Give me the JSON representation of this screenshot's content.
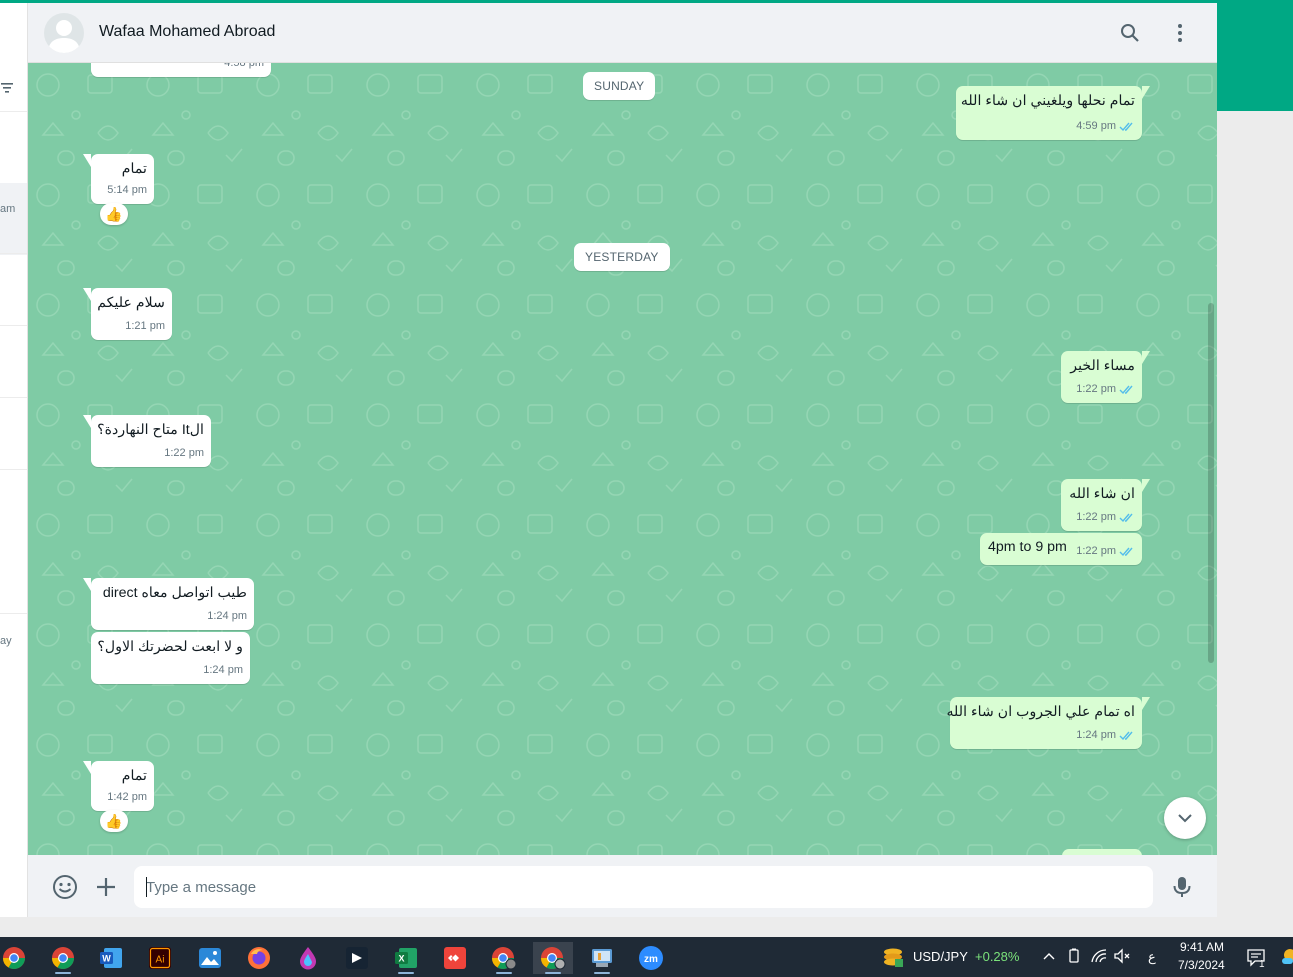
{
  "header": {
    "contact_name": "Wafaa Mohamed Abroad"
  },
  "chatlist": {
    "snippet_1": "am",
    "snippet_2": "ay"
  },
  "messages": [
    {
      "direction": "in",
      "text": "",
      "time": "4:58 pm"
    },
    {
      "type": "date",
      "text": "SUNDAY"
    },
    {
      "direction": "out",
      "text": "تمام نحلها ويلغيني ان شاء الله",
      "time": "4:59 pm",
      "status": "read"
    },
    {
      "direction": "in",
      "text": "تمام",
      "time": "5:14 pm",
      "reaction": "👍"
    },
    {
      "type": "date",
      "text": "YESTERDAY"
    },
    {
      "direction": "in",
      "text": "سلام عليكم",
      "time": "1:21 pm"
    },
    {
      "direction": "out",
      "text": "مساء الخير",
      "time": "1:22 pm",
      "status": "read"
    },
    {
      "direction": "in",
      "text": "الIt متاح النهاردة؟",
      "time": "1:22 pm"
    },
    {
      "direction": "out",
      "text": "ان شاء الله",
      "time": "1:22 pm",
      "status": "read"
    },
    {
      "direction": "out",
      "text": "4pm to 9 pm",
      "time": "1:22 pm",
      "status": "read"
    },
    {
      "direction": "in",
      "text": "طيب اتواصل معاه direct",
      "time": "1:24 pm"
    },
    {
      "direction": "in",
      "text": "و لا ابعت لحضرتك الاول؟",
      "time": "1:24 pm"
    },
    {
      "direction": "out",
      "text": "اه تمام علي الجروب ان شاء الله",
      "time": "1:24 pm",
      "status": "read"
    },
    {
      "direction": "in",
      "text": "تمام",
      "time": "1:42 pm",
      "reaction": "👍"
    }
  ],
  "composer": {
    "placeholder": "Type a message"
  },
  "taskbar": {
    "ticker_symbol": "USD/JPY",
    "ticker_change": "+0.28%",
    "input_lang": "ع",
    "time": "9:41 AM",
    "date": "7/3/2024",
    "notification_count": "1",
    "apps": [
      "chrome",
      "chrome",
      "word",
      "illustrator",
      "photos",
      "firefox",
      "paint",
      "capcut",
      "excel",
      "anydesk",
      "chrome-profile",
      "chrome-profile-active",
      "control-panel",
      "zoom"
    ]
  },
  "colors": {
    "brand_green": "#00a884",
    "chat_bg": "#7fcba5",
    "incoming_bubble": "#ffffff",
    "outgoing_bubble": "#d9fdd3",
    "read_tick": "#53bdeb",
    "taskbar_bg": "#1f2a36",
    "ticker_up": "#7be27b"
  }
}
